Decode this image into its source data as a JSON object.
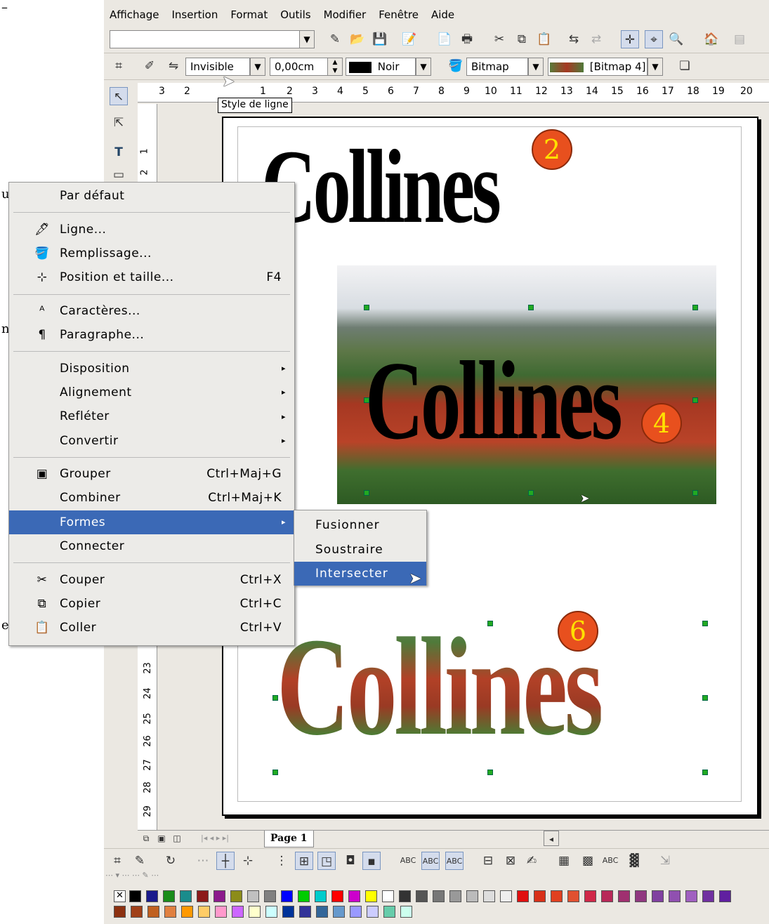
{
  "left_page_fragments": [
    "u",
    "n",
    "e"
  ],
  "menubar": [
    "Affichage",
    "Insertion",
    "Format",
    "Outils",
    "Modifier",
    "Fenêtre",
    "Aide"
  ],
  "line_toolbar": {
    "line_style": "Invisible",
    "line_width": "0,00cm",
    "line_color": "Noir",
    "area_type": "Bitmap",
    "area_fill": "[Bitmap 4]"
  },
  "tooltip": "Style de ligne",
  "ruler_h_ticks": [
    "3",
    "2",
    "1",
    "2",
    "3",
    "4",
    "5",
    "6",
    "7",
    "8",
    "9",
    "10",
    "11",
    "12",
    "13",
    "14",
    "15",
    "16",
    "17",
    "18",
    "19",
    "20"
  ],
  "ruler_v_ticks": [
    "1",
    "2",
    "23",
    "24",
    "25",
    "26",
    "27",
    "28",
    "29"
  ],
  "document": {
    "word": "Collines",
    "step_badges": [
      "2",
      "4",
      "6"
    ]
  },
  "context_menu": {
    "items": [
      {
        "label": "Par défaut",
        "icon": "",
        "shortcut": "",
        "submenu": false
      },
      {
        "label": "Ligne...",
        "icon": "line-icon",
        "shortcut": "",
        "submenu": false
      },
      {
        "label": "Remplissage...",
        "icon": "fill-icon",
        "shortcut": "",
        "submenu": false
      },
      {
        "label": "Position et taille...",
        "icon": "position-size-icon",
        "shortcut": "F4",
        "submenu": false
      },
      {
        "label": "Caractères...",
        "icon": "characters-icon",
        "shortcut": "",
        "submenu": false
      },
      {
        "label": "Paragraphe...",
        "icon": "paragraph-icon",
        "shortcut": "",
        "submenu": false
      },
      {
        "label": "Disposition",
        "icon": "",
        "shortcut": "",
        "submenu": true
      },
      {
        "label": "Alignement",
        "icon": "",
        "shortcut": "",
        "submenu": true
      },
      {
        "label": "Refléter",
        "icon": "",
        "shortcut": "",
        "submenu": true
      },
      {
        "label": "Convertir",
        "icon": "",
        "shortcut": "",
        "submenu": true
      },
      {
        "label": "Grouper",
        "icon": "group-icon",
        "shortcut": "Ctrl+Maj+G",
        "submenu": false
      },
      {
        "label": "Combiner",
        "icon": "",
        "shortcut": "Ctrl+Maj+K",
        "submenu": false
      },
      {
        "label": "Formes",
        "icon": "",
        "shortcut": "",
        "submenu": true,
        "selected": true
      },
      {
        "label": "Connecter",
        "icon": "",
        "shortcut": "",
        "submenu": false
      },
      {
        "label": "Couper",
        "icon": "scissors-icon",
        "shortcut": "Ctrl+X",
        "submenu": false
      },
      {
        "label": "Copier",
        "icon": "copy-icon",
        "shortcut": "Ctrl+C",
        "submenu": false
      },
      {
        "label": "Coller",
        "icon": "paste-icon",
        "shortcut": "Ctrl+V",
        "submenu": false
      }
    ]
  },
  "submenu_formes": {
    "items": [
      "Fusionner",
      "Soustraire",
      "Intersecter"
    ],
    "selected": "Intersecter"
  },
  "page_tab": "Page 1",
  "colors": {
    "menu_highlight": "#3b69b6",
    "badge_fill": "#e8501e",
    "badge_text": "#ffe000",
    "handle": "#22aa22"
  },
  "palette_row1": [
    "#000000",
    "#1a1a8c",
    "#1a8c1a",
    "#1a8c8c",
    "#8c1a1a",
    "#8c1a8c",
    "#8c8c1a",
    "#c0c0c0",
    "#808080",
    "#0000ff",
    "#00cc00",
    "#00cccc",
    "#ff0000",
    "#cc00cc",
    "#ffff00",
    "#ffffff",
    "#333333",
    "#555555",
    "#777777",
    "#999999",
    "#bbbbbb",
    "#dddddd",
    "#eeeeee",
    "#e01010",
    "#d83018",
    "#e04020",
    "#e05030",
    "#d02848",
    "#b82858",
    "#a03070",
    "#903880",
    "#8040a0",
    "#9050b0",
    "#a060c0",
    "#7030a0",
    "#6020a0"
  ],
  "palette_row2": [
    "#8c3010",
    "#a04018",
    "#c06020",
    "#e08040",
    "#ff9900",
    "#ffcc66",
    "#ff99cc",
    "#cc66ff",
    "#ffffcc",
    "#ccffff",
    "#003399",
    "#333399",
    "#336699",
    "#6699cc",
    "#9999ff",
    "#ccccff",
    "#66ccaa",
    "#ccffee"
  ]
}
